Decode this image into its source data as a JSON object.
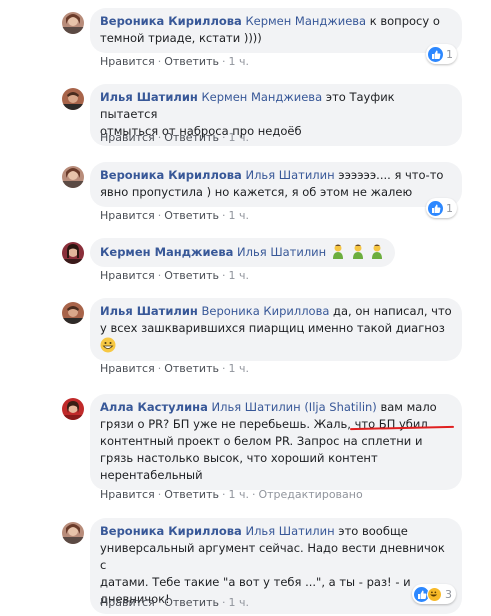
{
  "comments": [
    {
      "author": "Вероника Кириллова",
      "mention": "Кермен Манджиева",
      "lines": [
        " к вопросу о",
        "темной триаде, кстати ))))"
      ],
      "like": "Нравится",
      "reply": "Ответить",
      "time": "1 ч.",
      "reactions": {
        "count": "1",
        "icons": [
          "like-icon"
        ]
      }
    },
    {
      "author": "Илья Шатилин",
      "mention": "Кермен Манджиева",
      "lines": [
        " это Тауфик пытается",
        "отмыться от наброса про недоёб"
      ],
      "like": "Нравится",
      "reply": "Ответить",
      "time": "1 ч."
    },
    {
      "author": "Вероника Кириллова",
      "mention": "Илья Шатилин",
      "lines": [
        " ээээээ.... я что-то",
        "явно пропустила ) но кажется, я об этом не жалею"
      ],
      "like": "Нравится",
      "reply": "Ответить",
      "time": "1 ч.",
      "reactions": {
        "count": "1",
        "icons": [
          "like-icon"
        ]
      }
    },
    {
      "author": "Кермен Манджиева",
      "mention": "Илья Шатилин",
      "emoji": [
        "man-gesturing-icon",
        "man-gesturing-icon",
        "man-gesturing-icon"
      ],
      "like": "Нравится",
      "reply": "Ответить",
      "time": "1 ч."
    },
    {
      "author": "Илья Шатилин",
      "mention": "Вероника Кириллова",
      "lines": [
        " да, он написал, что",
        "у всех зашкварившихся пиарщиц именно такой диагноз"
      ],
      "emoji": [
        "grinning-face-icon"
      ],
      "like": "Нравится",
      "reply": "Ответить",
      "time": "1 ч."
    },
    {
      "author": "Алла Кастулина",
      "mention": "Илья Шатилин (Ilja Shatilin)",
      "lines": [
        " вам мало",
        "грязи о PR? БП уже не перебьешь. Жаль, что БП убил",
        "контентный проект о белом PR. Запрос на сплетни и",
        "грязь настолько высок, что хороший контент",
        "нерентабельный"
      ],
      "like": "Нравится",
      "reply": "Ответить",
      "time": "1 ч.",
      "edited": "Отредактировано"
    },
    {
      "author": "Вероника Кириллова",
      "mention": "Илья Шатилин",
      "lines": [
        " это вообще",
        "универсальный аргумент сейчас. Надо вести дневничок с",
        "датами. Тебе такие \"а вот у тебя ...\", а ты - раз! - и",
        "дневничок!"
      ],
      "like": "Нравится",
      "reply": "Ответить",
      "time": "1 ч.",
      "reactions": {
        "count": "3",
        "icons": [
          "like-icon",
          "haha-icon"
        ]
      }
    }
  ],
  "colors": {
    "name": "#385898",
    "bubble": "#f2f3f5",
    "meta": "#90949c",
    "underline": "#e02020",
    "like": "#2d88ff"
  }
}
